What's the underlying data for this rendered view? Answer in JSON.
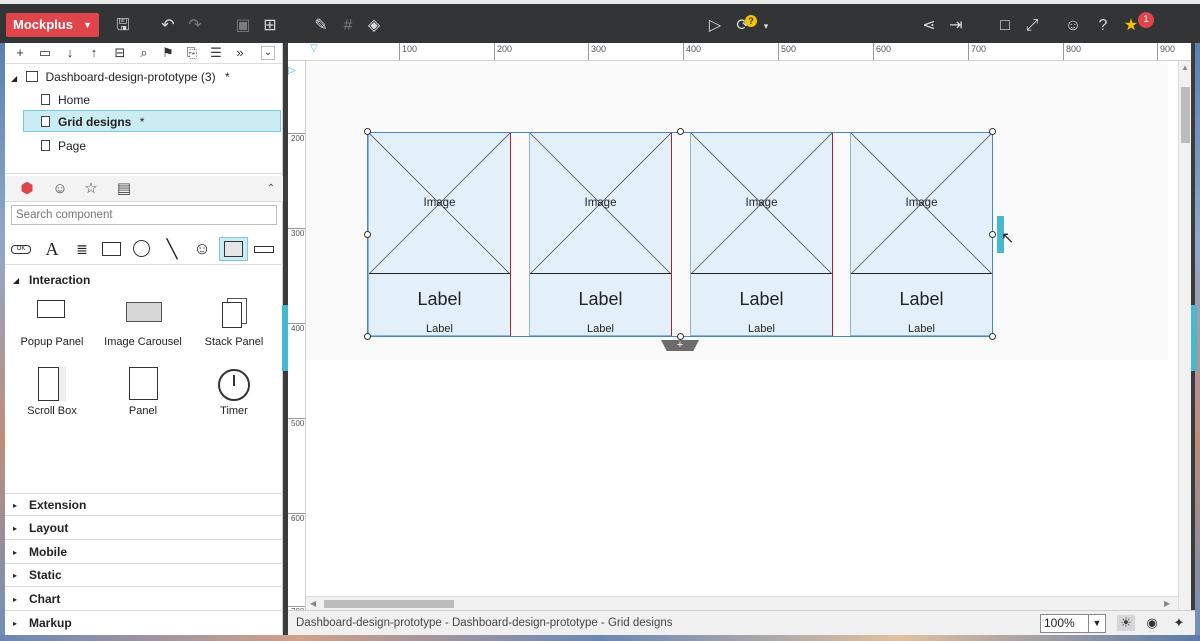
{
  "app": {
    "brand": "Mockplus",
    "notification_count": "1",
    "help_mark": "?"
  },
  "tree": {
    "project": "Dashboard-design-prototype (3)",
    "project_marker": "*",
    "pages": [
      {
        "label": "Home",
        "marker": ""
      },
      {
        "label": "Grid designs",
        "marker": "*"
      },
      {
        "label": "Page",
        "marker": ""
      }
    ]
  },
  "components": {
    "search_placeholder": "Search component",
    "sections": {
      "interaction": "Interaction",
      "extension": "Extension",
      "layout": "Layout",
      "mobile": "Mobile",
      "static": "Static",
      "chart": "Chart",
      "markup": "Markup"
    },
    "interaction_items": [
      "Popup Panel",
      "Image Carousel",
      "Stack Panel",
      "Scroll Box",
      "Panel",
      "Timer"
    ],
    "basic_ok": "OK"
  },
  "ruler": {
    "top": [
      "100",
      "200",
      "300",
      "400",
      "500",
      "600",
      "700",
      "800",
      "900"
    ],
    "left": [
      "200",
      "300",
      "400",
      "500",
      "600",
      "700"
    ]
  },
  "canvas": {
    "cards": [
      {
        "image": "Image",
        "label": "Label",
        "sublabel": "Label"
      },
      {
        "image": "Image",
        "label": "Label",
        "sublabel": "Label"
      },
      {
        "image": "Image",
        "label": "Label",
        "sublabel": "Label"
      },
      {
        "image": "Image",
        "label": "Label",
        "sublabel": "Label"
      }
    ],
    "add_symbol": "+"
  },
  "status": {
    "breadcrumb": "Dashboard-design-prototype - Dashboard-design-prototype - Grid designs",
    "zoom": "100%"
  },
  "colors": {
    "brand": "#e0454c",
    "accent": "#46b9cf",
    "selection": "#cbecf3",
    "card_fill": "#e3f0fa",
    "divider_red": "#b0202a"
  }
}
